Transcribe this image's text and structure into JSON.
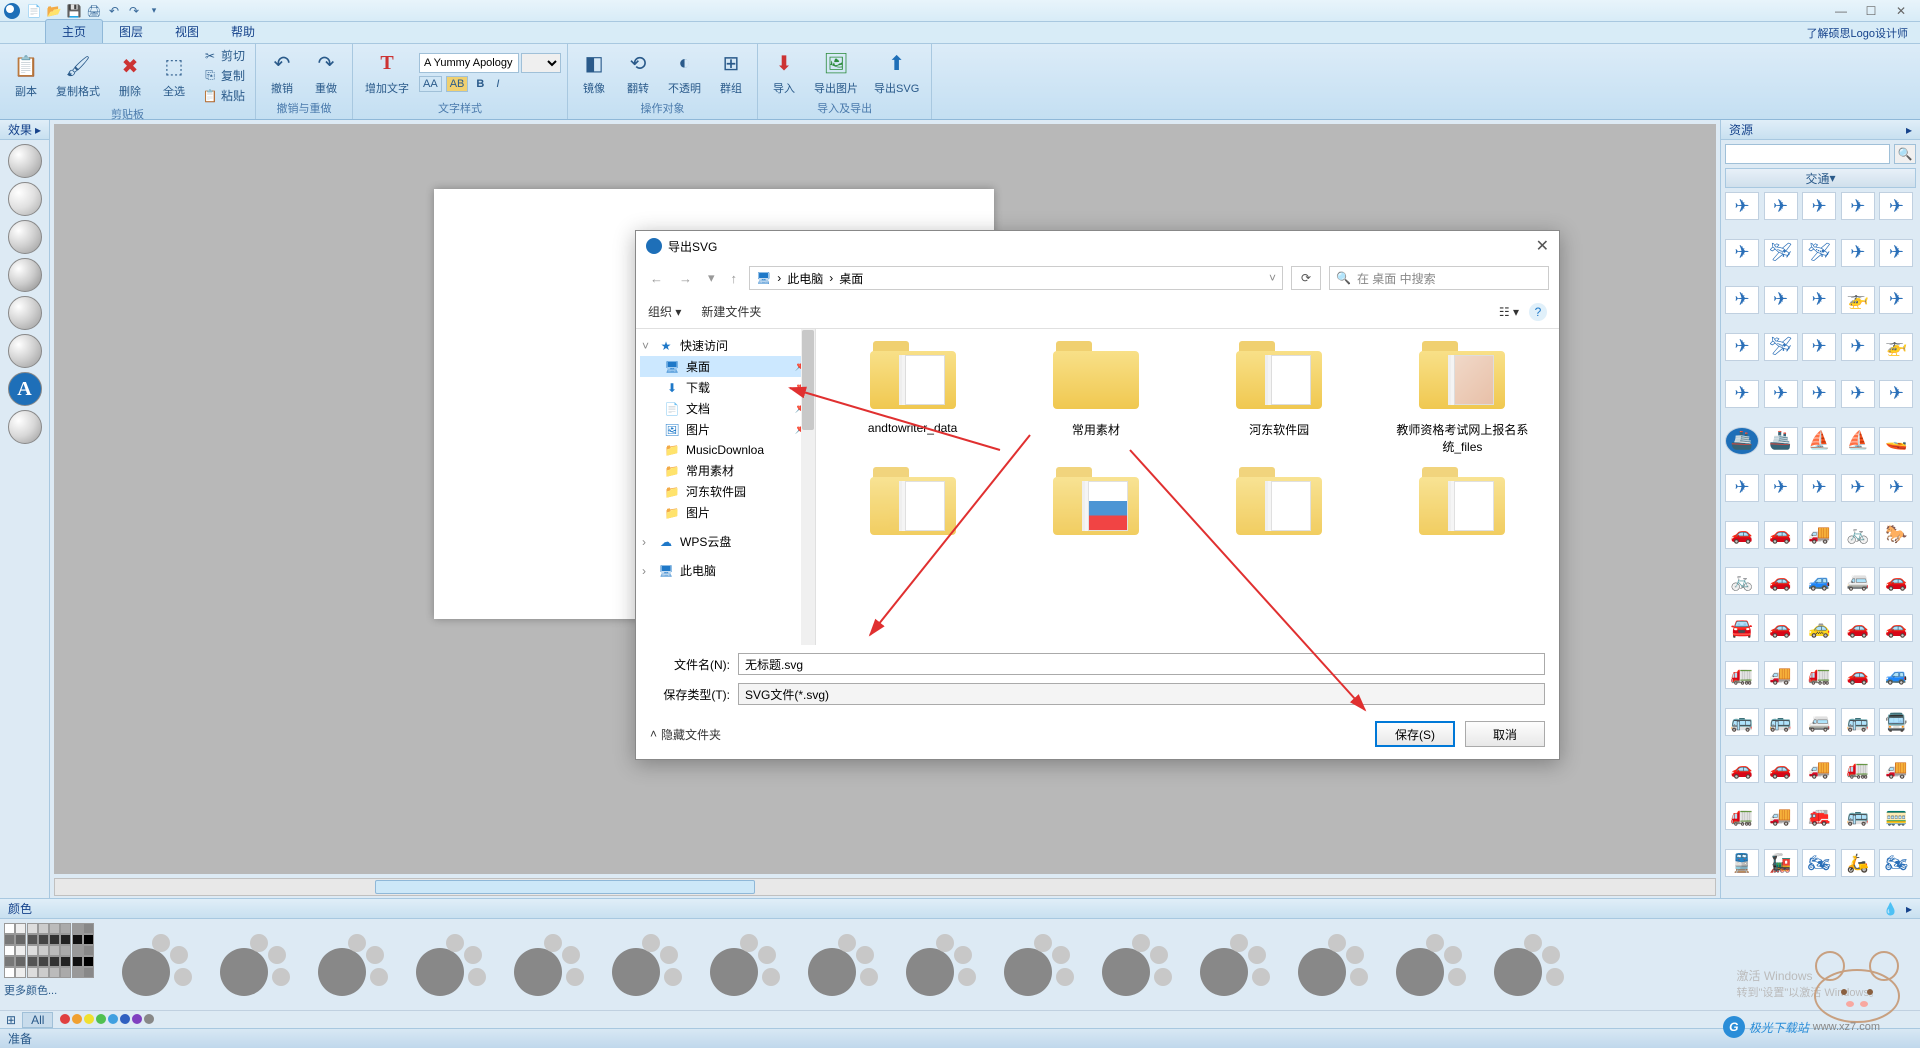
{
  "app": {
    "filename": ""
  },
  "menu": {
    "tabs": [
      "主页",
      "图层",
      "视图",
      "帮助"
    ],
    "active": 0
  },
  "about_link": "了解硕思Logo设计师",
  "ribbon": {
    "clipboard": {
      "label": "剪贴板",
      "copy": "副本",
      "paste_format": "复制格式",
      "delete": "删除",
      "select_all": "全选",
      "cut": "剪切",
      "copy2": "复制",
      "paste": "粘贴"
    },
    "undo": {
      "label": "撤销与重做",
      "undo": "撤销",
      "redo": "重做"
    },
    "text": {
      "label": "文字样式",
      "add_text": "增加文字",
      "font": "A Yummy Apology",
      "AA": "AA",
      "btn": "AB",
      "bold": "B",
      "italic": "I"
    },
    "object": {
      "label": "操作对象",
      "mirror": "镜像",
      "flip": "翻转",
      "opacity": "不透明",
      "group": "群组"
    },
    "io": {
      "label": "导入及导出",
      "import": "导入",
      "export_img": "导出图片",
      "export_svg": "导出SVG"
    }
  },
  "panels": {
    "effects": "效果",
    "resources": "资源",
    "colors": "颜色",
    "more_colors": "更多颜色...",
    "filter_all": "All"
  },
  "resources": {
    "category": "交通"
  },
  "dialog": {
    "title": "导出SVG",
    "breadcrumb": [
      "此电脑",
      "桌面"
    ],
    "search_placeholder": "在 桌面 中搜索",
    "organize": "组织",
    "new_folder": "新建文件夹",
    "tree": {
      "quick_access": "快速访问",
      "items": [
        "桌面",
        "下载",
        "文档",
        "图片",
        "MusicDownloa",
        "常用素材",
        "河东软件园",
        "图片"
      ],
      "wps": "WPS云盘",
      "this_pc": "此电脑"
    },
    "files": [
      "andtowriter_data",
      "常用素材",
      "河东软件园",
      "教师资格考试网上报名系统_files"
    ],
    "filename_label": "文件名(N):",
    "filename_value": "无标题.svg",
    "filetype_label": "保存类型(T):",
    "filetype_value": "SVG文件(*.svg)",
    "hide_folders": "隐藏文件夹",
    "save": "保存(S)",
    "cancel": "取消"
  },
  "status": {
    "ready": "准备"
  },
  "watermark": {
    "l1": "激活 Windows",
    "l2": "转到\"设置\"以激活 Windows。",
    "brand": "极光下载站",
    "brand_url": "www.xz7.com"
  }
}
